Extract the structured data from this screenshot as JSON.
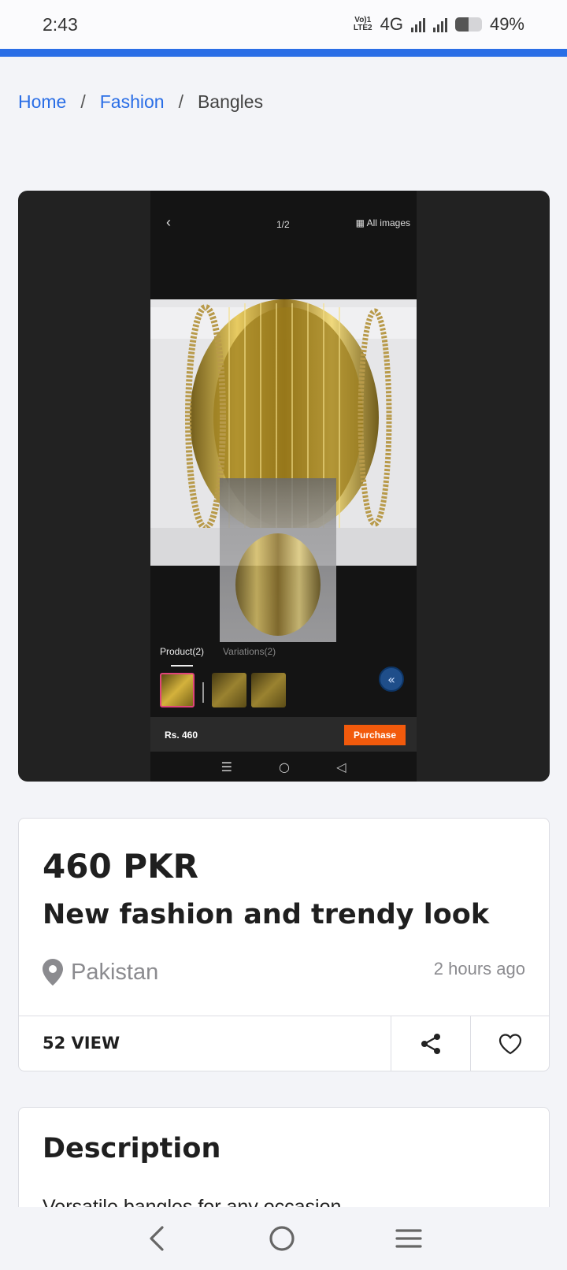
{
  "status_bar": {
    "time": "2:43",
    "volte_label": "Vo)) 1\nLTE2",
    "network": "4G",
    "battery": "49%",
    "battery_level": 0.49
  },
  "breadcrumb": {
    "items": [
      {
        "label": "Home"
      },
      {
        "label": "Fashion"
      },
      {
        "label": "Bangles"
      }
    ],
    "separator": "/"
  },
  "gallery": {
    "counter": "1/2",
    "all_images": "All images",
    "tabs": [
      "Product(2)",
      "Variations(2)"
    ],
    "price": "Rs. 460",
    "purchase": "Purchase"
  },
  "listing": {
    "price": "460 PKR",
    "title": "New fashion and trendy look",
    "location": "Pakistan",
    "posted": "2 hours ago",
    "views": "52 VIEW"
  },
  "description": {
    "heading": "Description",
    "text": "Versatile bangles for any occasion"
  },
  "colors": {
    "accent": "#2a6ee6",
    "purchase": "#f25a0c",
    "text": "#1f1f1f",
    "muted": "#8b8b8f"
  }
}
